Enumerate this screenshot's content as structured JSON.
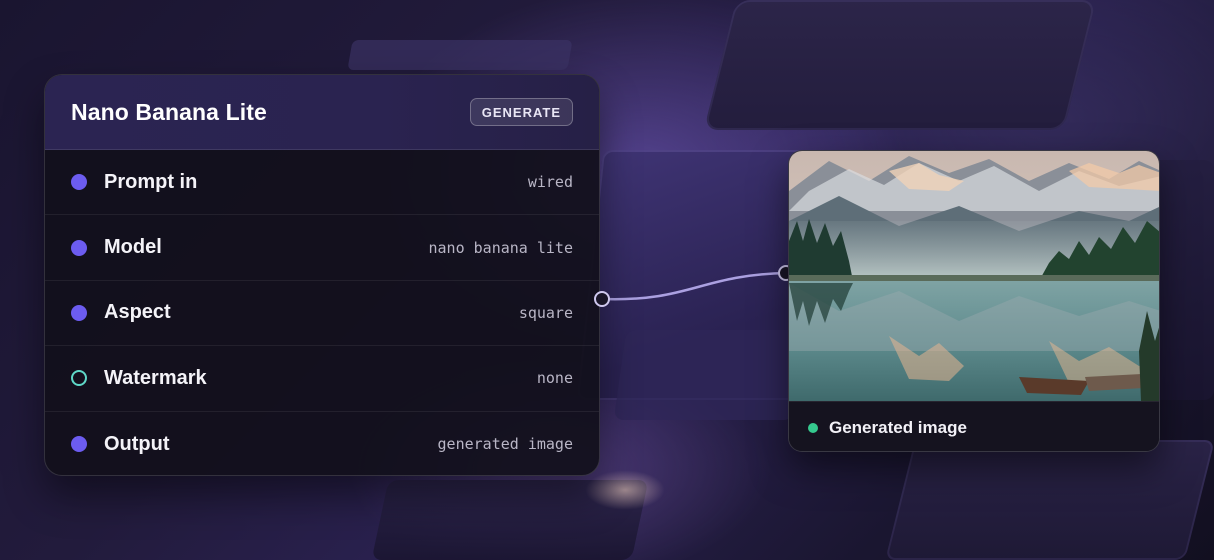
{
  "node": {
    "title": "Nano Banana Lite",
    "generate_label": "GENERATE",
    "params": [
      {
        "label": "Prompt in",
        "value": "wired",
        "port": "filled"
      },
      {
        "label": "Model",
        "value": "nano banana lite",
        "port": "filled"
      },
      {
        "label": "Aspect",
        "value": "square",
        "port": "filled"
      },
      {
        "label": "Watermark",
        "value": "none",
        "port": "hollow"
      },
      {
        "label": "Output",
        "value": "generated image",
        "port": "filled"
      }
    ]
  },
  "output_card": {
    "caption": "Generated image",
    "status_color": "#35c98e"
  },
  "colors": {
    "accent_port": "#6c5cf0",
    "hollow_port": "#5fd8c8",
    "connector": "#b9aef0"
  }
}
